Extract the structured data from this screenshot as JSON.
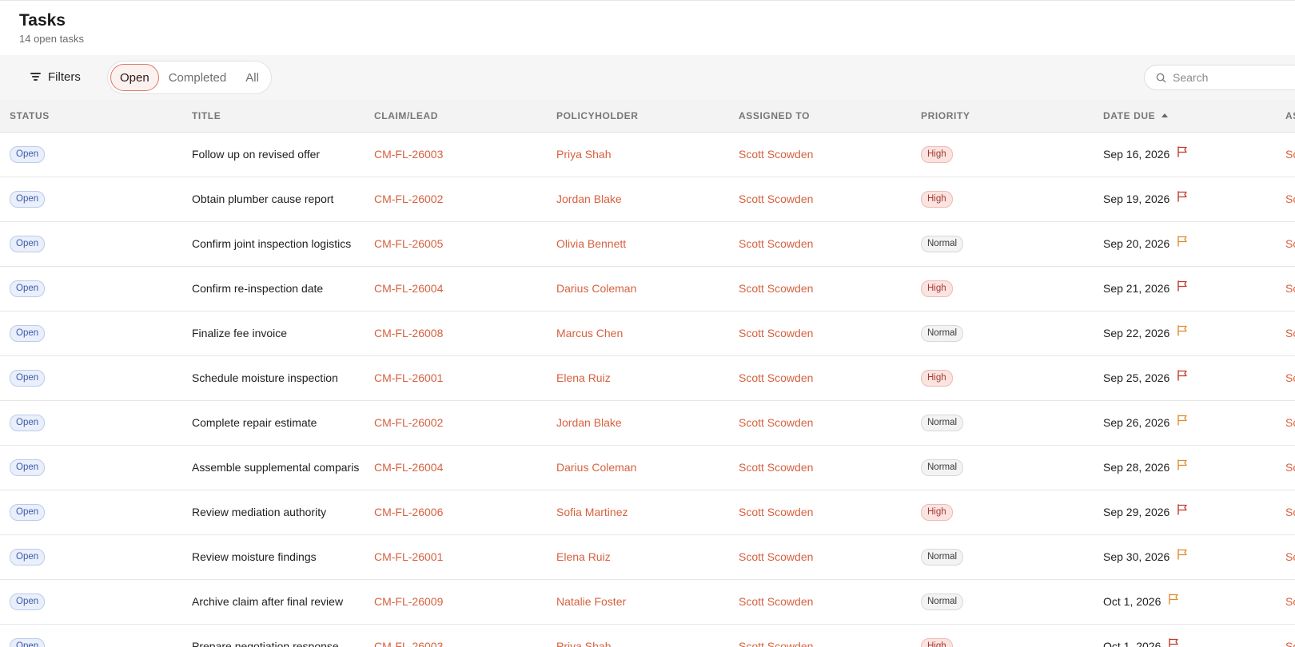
{
  "header": {
    "title": "Tasks",
    "subtitle": "14 open tasks"
  },
  "toolbar": {
    "filters_label": "Filters",
    "tabs": [
      {
        "label": "Open",
        "active": true
      },
      {
        "label": "Completed",
        "active": false
      },
      {
        "label": "All",
        "active": false
      }
    ],
    "search": {
      "placeholder": "Search",
      "value": ""
    }
  },
  "table": {
    "columns": [
      "STATUS",
      "TITLE",
      "CLAIM/LEAD",
      "POLICYHOLDER",
      "ASSIGNED TO",
      "PRIORITY",
      "DATE DUE",
      "AS"
    ],
    "sorted_column": "DATE DUE",
    "sort_direction": "ascending",
    "rows": [
      {
        "status": "Open",
        "title": "Follow up on revised offer",
        "claim": "CM-FL-26003",
        "policyholder": "Priya Shah",
        "assigned": "Scott Scowden",
        "priority": "High",
        "due": "Sep 16, 2026",
        "extra": "Sc"
      },
      {
        "status": "Open",
        "title": "Obtain plumber cause report",
        "claim": "CM-FL-26002",
        "policyholder": "Jordan Blake",
        "assigned": "Scott Scowden",
        "priority": "High",
        "due": "Sep 19, 2026",
        "extra": "Sc"
      },
      {
        "status": "Open",
        "title": "Confirm joint inspection logistics",
        "claim": "CM-FL-26005",
        "policyholder": "Olivia Bennett",
        "assigned": "Scott Scowden",
        "priority": "Normal",
        "due": "Sep 20, 2026",
        "extra": "Sc"
      },
      {
        "status": "Open",
        "title": "Confirm re-inspection date",
        "claim": "CM-FL-26004",
        "policyholder": "Darius Coleman",
        "assigned": "Scott Scowden",
        "priority": "High",
        "due": "Sep 21, 2026",
        "extra": "Sc"
      },
      {
        "status": "Open",
        "title": "Finalize fee invoice",
        "claim": "CM-FL-26008",
        "policyholder": "Marcus Chen",
        "assigned": "Scott Scowden",
        "priority": "Normal",
        "due": "Sep 22, 2026",
        "extra": "Sc"
      },
      {
        "status": "Open",
        "title": "Schedule moisture inspection",
        "claim": "CM-FL-26001",
        "policyholder": "Elena Ruiz",
        "assigned": "Scott Scowden",
        "priority": "High",
        "due": "Sep 25, 2026",
        "extra": "Sc"
      },
      {
        "status": "Open",
        "title": "Complete repair estimate",
        "claim": "CM-FL-26002",
        "policyholder": "Jordan Blake",
        "assigned": "Scott Scowden",
        "priority": "Normal",
        "due": "Sep 26, 2026",
        "extra": "Sc"
      },
      {
        "status": "Open",
        "title": "Assemble supplemental comparis",
        "claim": "CM-FL-26004",
        "policyholder": "Darius Coleman",
        "assigned": "Scott Scowden",
        "priority": "Normal",
        "due": "Sep 28, 2026",
        "extra": "Sc"
      },
      {
        "status": "Open",
        "title": "Review mediation authority",
        "claim": "CM-FL-26006",
        "policyholder": "Sofia Martinez",
        "assigned": "Scott Scowden",
        "priority": "High",
        "due": "Sep 29, 2026",
        "extra": "Sc"
      },
      {
        "status": "Open",
        "title": "Review moisture findings",
        "claim": "CM-FL-26001",
        "policyholder": "Elena Ruiz",
        "assigned": "Scott Scowden",
        "priority": "Normal",
        "due": "Sep 30, 2026",
        "extra": "Sc"
      },
      {
        "status": "Open",
        "title": "Archive claim after final review",
        "claim": "CM-FL-26009",
        "policyholder": "Natalie Foster",
        "assigned": "Scott Scowden",
        "priority": "Normal",
        "due": "Oct 1, 2026",
        "extra": "Sc"
      },
      {
        "status": "Open",
        "title": "Prepare negotiation response",
        "claim": "CM-FL-26003",
        "policyholder": "Priya Shah",
        "assigned": "Scott Scowden",
        "priority": "High",
        "due": "Oct 1, 2026",
        "extra": "Sc"
      }
    ]
  },
  "colors": {
    "accent": "#d6613f",
    "flag_high": "#c0392b",
    "flag_normal": "#e08a2e",
    "status_badge": "#3d5aa8"
  },
  "icons": {
    "filters": "filter-lines-icon",
    "search": "search-icon",
    "due_flag": "flag-icon",
    "sort": "sort-ascending-icon"
  }
}
